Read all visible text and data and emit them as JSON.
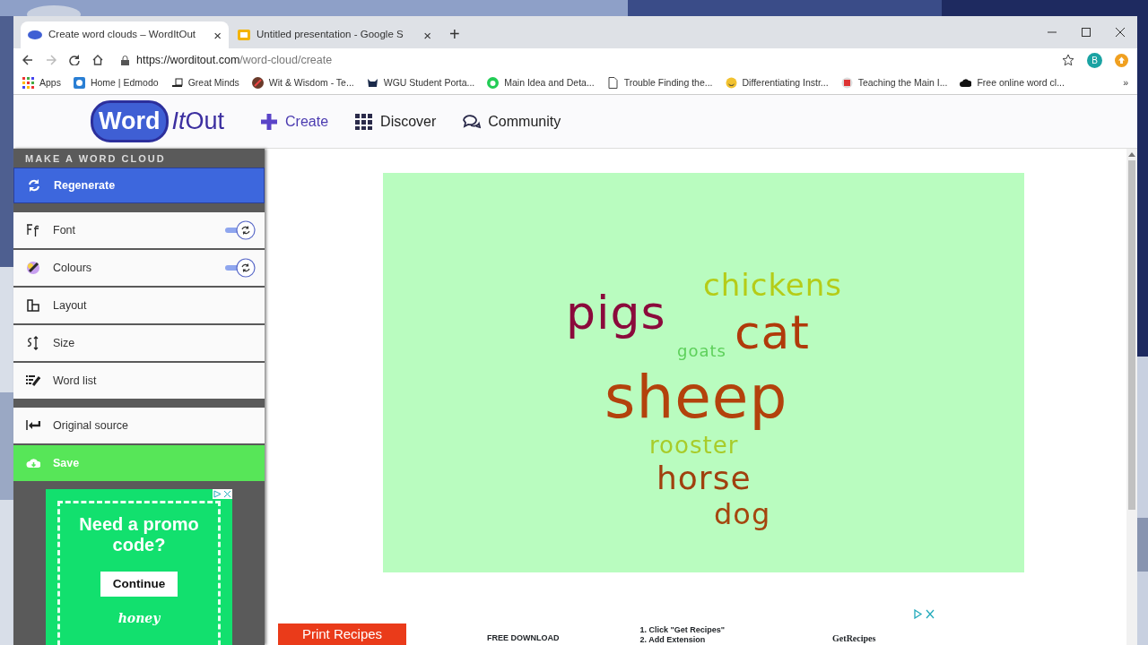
{
  "browser": {
    "tabs": [
      {
        "title": "Create word clouds – WordItOut",
        "selected": true,
        "close": "×"
      },
      {
        "title": "Untitled presentation - Google S",
        "selected": false,
        "close": "×"
      }
    ],
    "new_tab": "+",
    "url": {
      "host": "https://worditout.com",
      "path": "/word-cloud/create"
    },
    "profile": "B",
    "bookmarks": [
      {
        "label": "Apps"
      },
      {
        "label": "Home | Edmodo"
      },
      {
        "label": "Great Minds"
      },
      {
        "label": "Wit & Wisdom - Te..."
      },
      {
        "label": "WGU Student Porta..."
      },
      {
        "label": "Main Idea and Deta..."
      },
      {
        "label": "Trouble Finding the..."
      },
      {
        "label": "Differentiating Instr..."
      },
      {
        "label": "Teaching the Main I..."
      },
      {
        "label": "Free online word cl..."
      }
    ],
    "bookmarks_more": "»"
  },
  "site": {
    "logo": {
      "boxed": "Word",
      "italic": "It",
      "rest": "Out"
    },
    "nav": [
      {
        "label": "Create",
        "selected": true
      },
      {
        "label": "Discover",
        "selected": false
      },
      {
        "label": "Community",
        "selected": false
      }
    ]
  },
  "panel": {
    "heading": "MAKE A WORD CLOUD",
    "groups": [
      {
        "items": [
          {
            "label": "Regenerate",
            "kind": "primary"
          }
        ]
      },
      {
        "items": [
          {
            "label": "Font",
            "kind": "toggle",
            "on": true
          },
          {
            "label": "Colours",
            "kind": "toggle",
            "on": true
          },
          {
            "label": "Layout",
            "kind": "plain"
          },
          {
            "label": "Size",
            "kind": "plain"
          },
          {
            "label": "Word list",
            "kind": "plain"
          }
        ]
      },
      {
        "items": [
          {
            "label": "Original source",
            "kind": "plain"
          },
          {
            "label": "Save",
            "kind": "save"
          }
        ]
      }
    ]
  },
  "side_ad": {
    "headline": "Need a promo code?",
    "button": "Continue",
    "brand": "honey"
  },
  "cloud": {
    "words": [
      {
        "text": "pigs",
        "color": "#8b0a3c"
      },
      {
        "text": "chickens",
        "color": "#b5cc18"
      },
      {
        "text": "goats",
        "color": "#5dd05a"
      },
      {
        "text": "cat",
        "color": "#b03a0a"
      },
      {
        "text": "sheep",
        "color": "#b3420c"
      },
      {
        "text": "rooster",
        "color": "#a8cc2a"
      },
      {
        "text": "horse",
        "color": "#a0400e"
      },
      {
        "text": "dog",
        "color": "#a5460e"
      }
    ]
  },
  "bottom_ad": {
    "button": "Print Recipes",
    "download": "FREE DOWNLOAD",
    "steps": [
      "1. Click \"Get Recipes\"",
      "2. Add Extension"
    ],
    "brand": "GetRecipes"
  }
}
